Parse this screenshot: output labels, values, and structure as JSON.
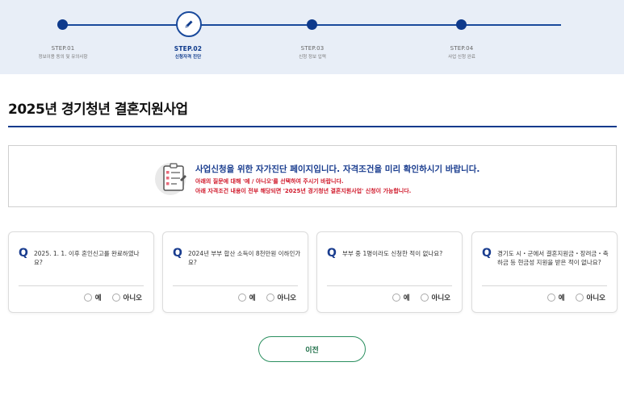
{
  "steps": [
    {
      "num": "STEP.01",
      "desc": "정보이용 동의 및 유의사항",
      "active": false
    },
    {
      "num": "STEP.02",
      "desc": "신청자격 진단",
      "active": true
    },
    {
      "num": "STEP.03",
      "desc": "신청 정보 입력",
      "active": false
    },
    {
      "num": "STEP.04",
      "desc": "사업 신청 완료",
      "active": false
    }
  ],
  "page": {
    "title": "2025년 경기청년 결혼지원사업"
  },
  "notice": {
    "main": "사업신청을 위한 자가진단 페이지입니다. 자격조건을 미리 확인하시기 바랍니다.",
    "sub1": "아래의 질문에 대해 '예 / 아니오'를 선택하여 주시기 바랍니다.",
    "sub2": "아래 자격조건 내용이 전부 해당되면 '2025년 경기청년 결혼지원사업' 신청이 가능합니다."
  },
  "questions": [
    {
      "mark": "Q",
      "text": "2025. 1. 1. 이후 혼인신고를 완료하였나요?",
      "yes": "예",
      "no": "아니오"
    },
    {
      "mark": "Q",
      "text": "2024년 부부 합산 소득이 8천만원 이하인가요?",
      "yes": "예",
      "no": "아니오"
    },
    {
      "mark": "Q",
      "text": "부부 중 1명이라도 신청한 적이 없나요?",
      "yes": "예",
      "no": "아니오"
    },
    {
      "mark": "Q",
      "text": "경기도 시・군에서 결혼지원금・장려금・축하금 등 현금성 지원을 받은 적이 없나요?",
      "yes": "예",
      "no": "아니오"
    }
  ],
  "buttons": {
    "prev": "이전"
  },
  "colors": {
    "primary": "#0e3a8c",
    "accent_red": "#d0182a",
    "button_green": "#2a8f5f",
    "band": "#e8eef7"
  }
}
